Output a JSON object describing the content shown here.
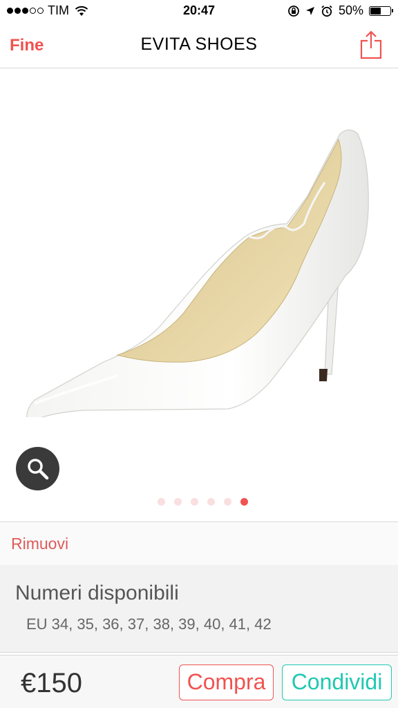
{
  "status_bar": {
    "carrier": "TIM",
    "time": "20:47",
    "battery": "50%"
  },
  "nav": {
    "back_label": "Fine",
    "title": "EVITA SHOES",
    "share_icon": "share-icon"
  },
  "product": {
    "image": "white-pointed-pump-shoe",
    "zoom_icon": "magnifier-icon",
    "page_count": 6,
    "active_page": 6
  },
  "remove_label": "Rimuovi",
  "sizes": {
    "title": "Numeri disponibili",
    "list": "EU 34, 35, 36, 37, 38, 39, 40, 41, 42"
  },
  "footer": {
    "price": "€150",
    "buy_label": "Compra",
    "share_label": "Condividi"
  },
  "colors": {
    "accent_red": "#ef5350",
    "accent_teal": "#1fc8b0"
  }
}
